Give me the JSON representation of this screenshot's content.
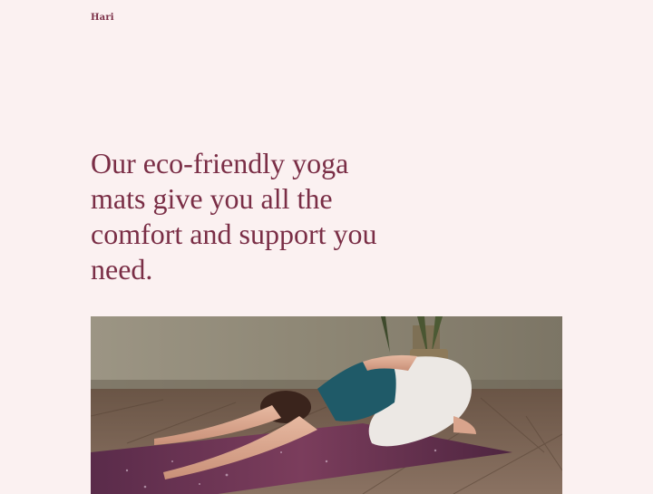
{
  "header": {
    "brand": "Hari"
  },
  "hero": {
    "headline": "Our eco-friendly yoga mats give you all the comfort and support you need.",
    "image_subject": "woman-in-childs-pose-on-yoga-mat"
  },
  "colors": {
    "background": "#fbf1f1",
    "accent": "#7a2e46"
  }
}
